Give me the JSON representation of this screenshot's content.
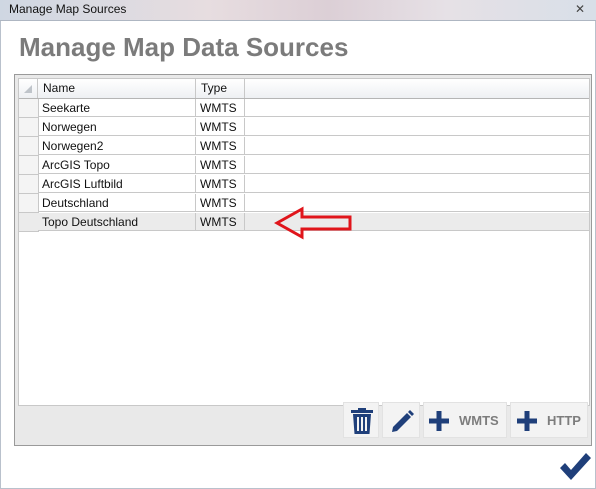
{
  "window": {
    "title": "Manage Map Sources",
    "close_glyph": "✕"
  },
  "heading": "Manage Map Data Sources",
  "table": {
    "columns": [
      "Name",
      "Type",
      ""
    ],
    "rows": [
      {
        "name": "Seekarte",
        "type": "WMTS"
      },
      {
        "name": "Norwegen",
        "type": "WMTS"
      },
      {
        "name": "Norwegen2",
        "type": "WMTS"
      },
      {
        "name": "ArcGIS Topo",
        "type": "WMTS"
      },
      {
        "name": "ArcGIS Luftbild",
        "type": "WMTS"
      },
      {
        "name": "Deutschland",
        "type": "WMTS"
      },
      {
        "name": "Topo Deutschland",
        "type": "WMTS"
      }
    ],
    "selected_row": "Topo Deutschland"
  },
  "toolbar": {
    "delete_icon": "trash-icon",
    "edit_icon": "pencil-icon",
    "add_wmts_label": "WMTS",
    "add_http_label": "HTTP"
  },
  "confirm_icon": "checkmark-icon",
  "colors": {
    "accent_blue": "#1f3f7a",
    "heading_gray": "#7b7b7b",
    "annotation_red": "#e0151b"
  }
}
